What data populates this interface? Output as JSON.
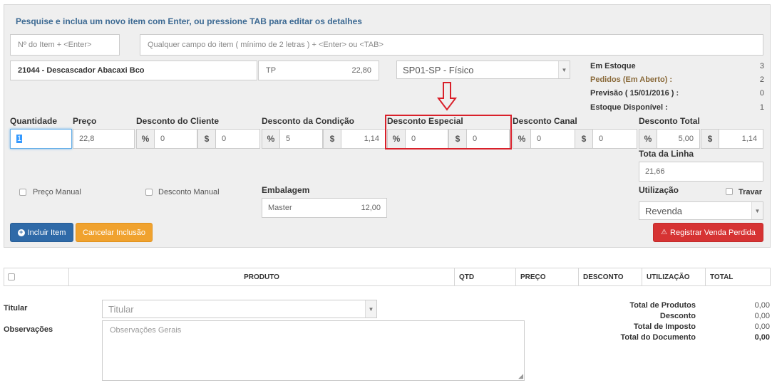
{
  "hint": "Pesquise e inclua um novo item com Enter, ou pressione TAB para editar os detalhes",
  "item_number": {
    "placeholder": "Nº do Item + <Enter>"
  },
  "search": {
    "placeholder": "Qualquer campo do item ( mínimo de 2 letras ) + <Enter> ou <TAB>"
  },
  "product": {
    "name": "21044 - Descascador Abacaxi Bco",
    "price_table": "TP",
    "table_price": "22,80",
    "warehouse": "SP01-SP - Físico"
  },
  "stock": [
    {
      "label": "Em Estoque",
      "value": "3"
    },
    {
      "label": "Pedidos (Em Aberto) :",
      "value": "2"
    },
    {
      "label": "Previsão ( 15/01/2016 ) :",
      "value": "0"
    },
    {
      "label": "Estoque Disponível :",
      "value": "1"
    }
  ],
  "fields": {
    "quantidade_label": "Quantidade",
    "quantidade": "1",
    "preco_label": "Preço",
    "preco": "22,8",
    "desconto_cliente_label": "Desconto do Cliente",
    "desconto_cliente_pct": "0",
    "desconto_cliente_val": "0",
    "desconto_condicao_label": "Desconto da Condição",
    "desconto_condicao_pct": "5",
    "desconto_condicao_val": "1,14",
    "desconto_especial_label": "Desconto Especial",
    "desconto_especial_pct": "0",
    "desconto_especial_val": "0",
    "desconto_canal_label": "Desconto Canal",
    "desconto_canal_pct": "0",
    "desconto_canal_val": "0",
    "desconto_total_label": "Desconto Total",
    "desconto_total_pct": "5,00",
    "desconto_total_val": "1,14",
    "total_linha_label": "Tota da Linha",
    "total_linha": "21,66",
    "pct_symbol": "%",
    "cur_symbol": "$"
  },
  "options": {
    "preco_manual": "Preço Manual",
    "desconto_manual": "Desconto Manual",
    "embalagem_label": "Embalagem",
    "embalagem_name": "Master",
    "embalagem_value": "12,00",
    "utilizacao_label": "Utilização",
    "travar": "Travar",
    "utilizacao_value": "Revenda"
  },
  "buttons": {
    "incluir": "Incluir Item",
    "cancelar": "Cancelar Inclusão",
    "registrar": "Registrar Venda Perdida"
  },
  "table": {
    "columns": [
      "PRODUTO",
      "QTD",
      "PREÇO",
      "DESCONTO",
      "UTILIZAÇÃO",
      "TOTAL"
    ]
  },
  "footer": {
    "titular_label": "Titular",
    "titular_placeholder": "Titular",
    "observacoes_label": "Observações",
    "observacoes_placeholder": "Observações Gerais",
    "totals": [
      {
        "label": "Total de Produtos",
        "value": "0,00"
      },
      {
        "label": "Desconto",
        "value": "0,00"
      },
      {
        "label": "Total de Imposto",
        "value": "0,00"
      },
      {
        "label": "Total do Documento",
        "value": "0,00"
      }
    ]
  },
  "colors": {
    "primary": "#2f6aa8",
    "warning": "#f0a22e",
    "danger": "#d63333",
    "highlight": "#d9202a"
  }
}
